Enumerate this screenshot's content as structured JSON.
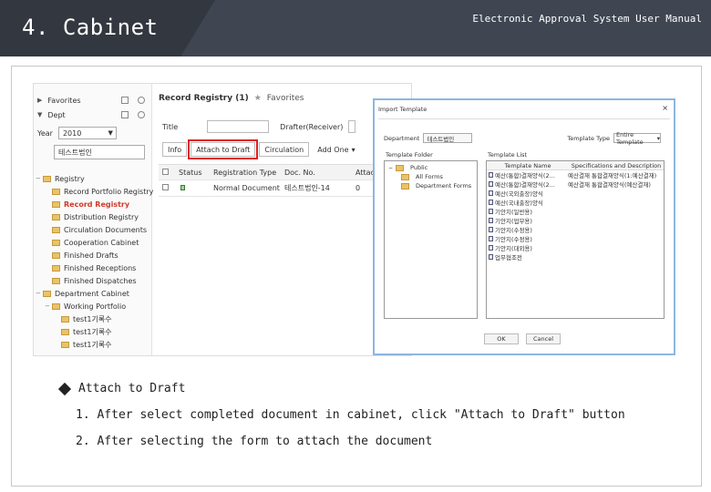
{
  "header": {
    "title": "4. Cabinet",
    "subtitle": "Electronic Approval System User Manual"
  },
  "app": {
    "sidebar": {
      "favorites": "Favorites",
      "dept": "Dept",
      "year_label": "Year",
      "year_value": "2010",
      "search_value": "테스트법인",
      "items": [
        {
          "label": "Registry",
          "active": false
        },
        {
          "label": "Record Portfolio Registry",
          "active": false
        },
        {
          "label": "Record Registry",
          "active": true
        },
        {
          "label": "Distribution Registry",
          "active": false
        },
        {
          "label": "Circulation Documents",
          "active": false
        },
        {
          "label": "Cooperation Cabinet",
          "active": false
        },
        {
          "label": "Finished Drafts",
          "active": false
        },
        {
          "label": "Finished Receptions",
          "active": false
        },
        {
          "label": "Finished Dispatches",
          "active": false
        },
        {
          "label": "Department Cabinet",
          "active": false
        },
        {
          "label": "Working Portfolio",
          "active": false
        },
        {
          "label": "test1기록수",
          "active": false
        },
        {
          "label": "test1기록수",
          "active": false
        },
        {
          "label": "test1기록수",
          "active": false
        }
      ]
    },
    "main": {
      "registry_title": "Record Registry (1)",
      "favorite_label": "Favorites",
      "filter_title_label": "Title",
      "filter_drafter_label": "Drafter(Receiver)",
      "buttons": {
        "info": "Info",
        "attach_to_draft": "Attach to Draft",
        "circulation": "Circulation",
        "add_one": "Add One"
      },
      "columns": [
        "Status",
        "Registration Type",
        "Doc. No.",
        "Attach"
      ],
      "rows": [
        {
          "type": "Normal Document",
          "doc_no": "테스트법인-14",
          "attach": "0"
        }
      ]
    }
  },
  "dialog": {
    "title": "Import Template",
    "close": "×",
    "department_label": "Department",
    "department_value": "테스트법인",
    "template_type_label": "Template Type",
    "template_type_value": "Entire Template",
    "template_folder_label": "Template Folder",
    "template_list_label": "Template List",
    "folders": [
      "Public",
      "All Forms",
      "Department Forms"
    ],
    "list_columns": [
      "Template Name",
      "Specifications and Description"
    ],
    "templates": [
      {
        "name": "예산(통합)결재양식(2...",
        "desc": "예산결재 통합결재양식(1:예산결재)"
      },
      {
        "name": "예산(통합)결재양식(2...",
        "desc": "예산결재 통합결재양식(예산결재)"
      },
      {
        "name": "예산(국외출장)양식",
        "desc": ""
      },
      {
        "name": "예산(국내출장)양식",
        "desc": ""
      },
      {
        "name": "기안지(일반용)",
        "desc": ""
      },
      {
        "name": "기안지(업무용)",
        "desc": ""
      },
      {
        "name": "기안지(수정용)",
        "desc": ""
      },
      {
        "name": "기안지(수정용)",
        "desc": ""
      },
      {
        "name": "기안지(대외용)",
        "desc": ""
      },
      {
        "name": "업무협조전",
        "desc": ""
      }
    ],
    "ok": "OK",
    "cancel": "Cancel"
  },
  "instructions": {
    "heading": "Attach to Draft",
    "step1": "1. After select completed document in cabinet, click \"Attach to Draft\" button",
    "step2": "2. After selecting the form to attach the document"
  }
}
